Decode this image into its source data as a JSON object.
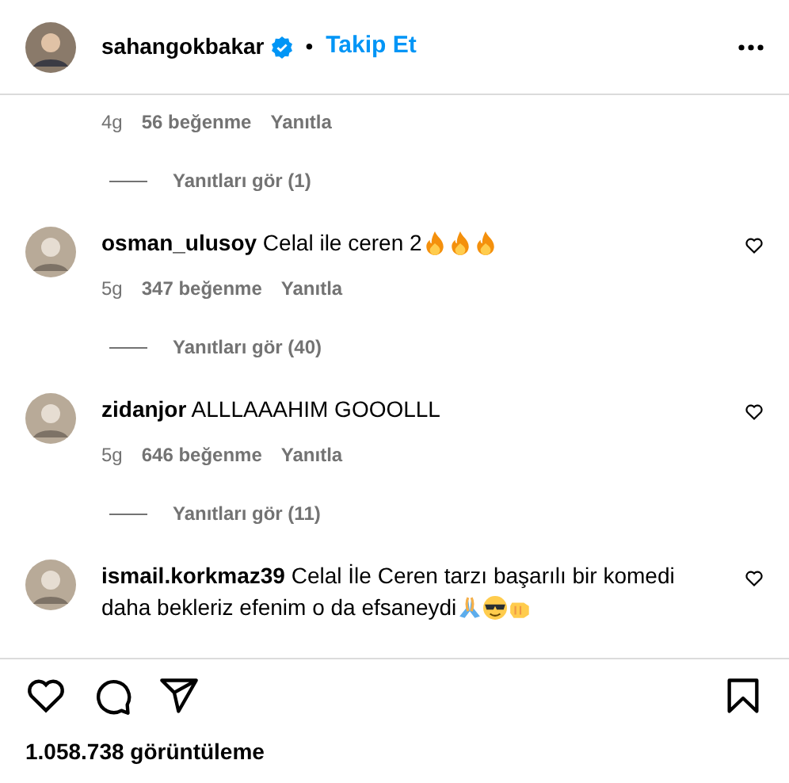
{
  "header": {
    "username": "sahangokbakar",
    "verified": true,
    "separator": "•",
    "follow_label": "Takip Et"
  },
  "comments": [
    {
      "time": "4g",
      "likes": "56 beğenme",
      "reply_label": "Yanıtla",
      "replies": "Yanıtları gör (1)"
    },
    {
      "username": "osman_ulusoy",
      "text": "Celal ile ceren 2",
      "emojis": [
        {
          "kind": "fire"
        },
        {
          "kind": "fire"
        },
        {
          "kind": "fire"
        }
      ],
      "liked": false,
      "time": "5g",
      "likes": "347 beğenme",
      "reply_label": "Yanıtla",
      "replies": "Yanıtları gör (40)"
    },
    {
      "username": "zidanjor",
      "text": "ALLLAAAHIM GOOOLLL",
      "liked": false,
      "time": "5g",
      "likes": "646 beğenme",
      "reply_label": "Yanıtla",
      "replies": "Yanıtları gör (11)"
    },
    {
      "username": "ismail.korkmaz39",
      "text": "Celal İle Ceren tarzı başarılı bir komedi daha bekleriz efenim o da efsaneydi",
      "emojis": [
        {
          "kind": "pray"
        },
        {
          "kind": "sunglasses"
        },
        {
          "kind": "fist"
        }
      ],
      "liked": false
    }
  ],
  "actions": {
    "liked": false,
    "saved": false
  },
  "views": "1.058.738 görüntüleme"
}
